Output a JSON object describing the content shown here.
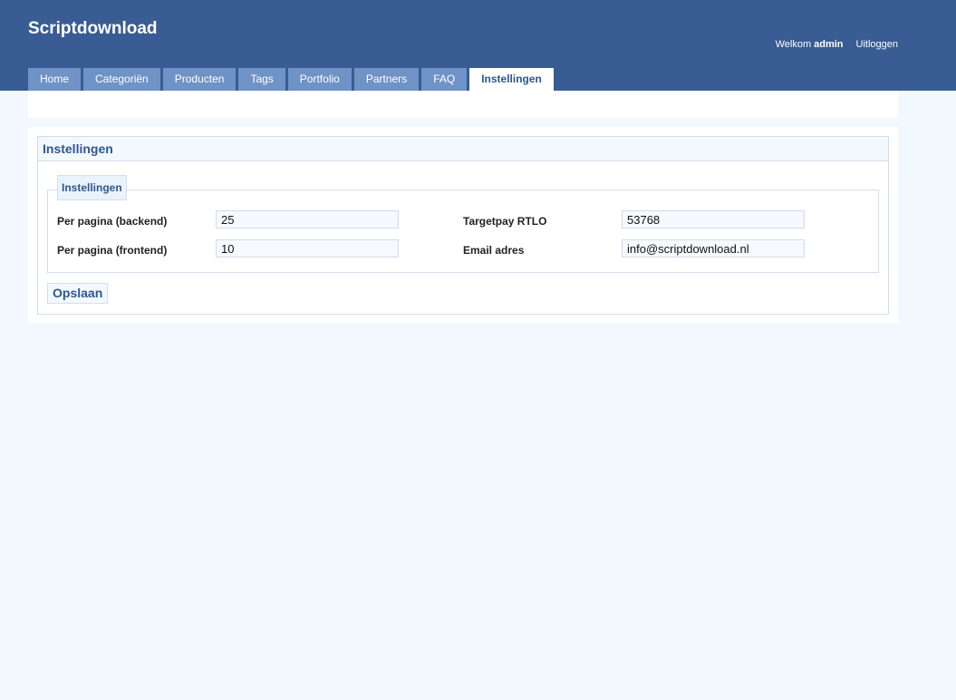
{
  "header": {
    "title": "Scriptdownload",
    "welcome_label": "Welkom",
    "username": "admin",
    "logout_label": "Uitloggen"
  },
  "nav": {
    "tabs": [
      {
        "label": "Home"
      },
      {
        "label": "Categoriën"
      },
      {
        "label": "Producten"
      },
      {
        "label": "Tags"
      },
      {
        "label": "Portfolio"
      },
      {
        "label": "Partners"
      },
      {
        "label": "FAQ"
      },
      {
        "label": "Instellingen",
        "active": true
      }
    ]
  },
  "panel": {
    "title": "Instellingen",
    "fieldset_legend": "Instellingen",
    "fields": [
      {
        "label": "Per pagina (backend)",
        "value": "25"
      },
      {
        "label": "Per pagina (frontend)",
        "value": "10"
      },
      {
        "label": "Targetpay RTLO",
        "value": "53768"
      },
      {
        "label": "Email adres",
        "value": "info@scriptdownload.nl"
      }
    ],
    "save_label": "Opslaan"
  },
  "colors": {
    "header_bg": "#385c93",
    "tab_bg": "#6f92c7",
    "accent_text": "#2f5691",
    "page_bg": "#f2f8fe"
  }
}
